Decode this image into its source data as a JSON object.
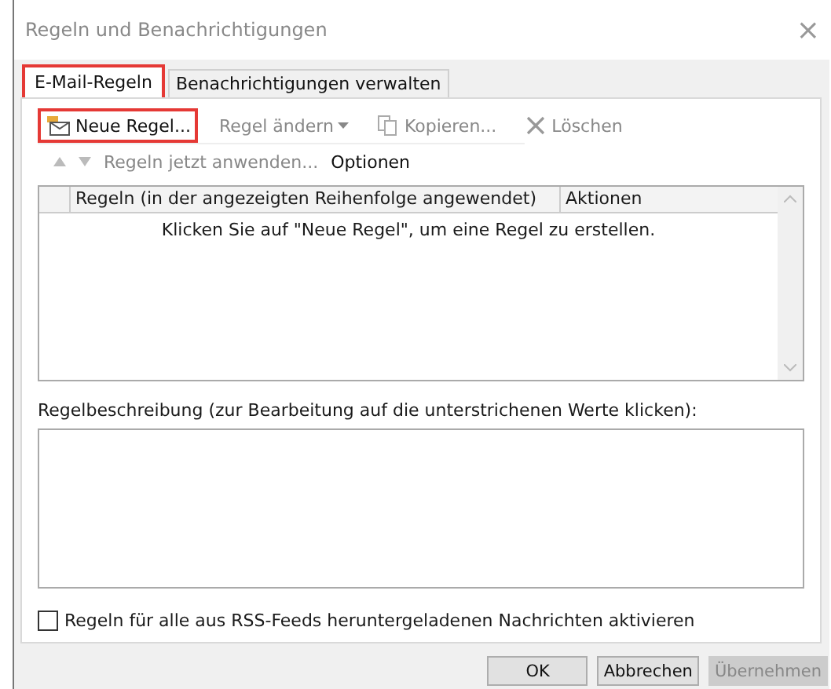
{
  "window": {
    "title": "Regeln und Benachrichtigungen",
    "close": "×"
  },
  "tabs": [
    {
      "label": "E-Mail-Regeln",
      "selected": true,
      "highlighted": true
    },
    {
      "label": "Benachrichtigungen verwalten",
      "selected": false,
      "highlighted": false
    }
  ],
  "toolbar": [
    {
      "kind": "new",
      "label": "Neue Regel...",
      "disabled": false,
      "highlighted": true
    },
    {
      "kind": "change",
      "label": "Regel ändern",
      "disabled": true,
      "highlighted": false
    },
    {
      "kind": "copy",
      "label": "Kopieren...",
      "disabled": true,
      "highlighted": false
    },
    {
      "kind": "delete",
      "label": "Löschen",
      "disabled": true,
      "highlighted": false
    }
  ],
  "secondary_toolbar": {
    "move_up_disabled": true,
    "move_down_disabled": true,
    "links": [
      {
        "label": "Regeln jetzt anwenden...",
        "disabled": true
      },
      {
        "label": "Optionen",
        "disabled": false
      }
    ]
  },
  "table": {
    "columns": [
      "Regeln (in der angezeigten Reihenfolge angewendet)",
      "Aktionen"
    ],
    "empty_message": "Klicken Sie auf \"Neue Regel\", um eine Regel zu erstellen."
  },
  "description": {
    "label": "Regelbeschreibung (zur Bearbeitung auf die unterstrichenen Werte klicken):"
  },
  "rss_checkbox": {
    "label": "Regeln für alle aus RSS-Feeds heruntergeladenen Nachrichten aktivieren",
    "checked": false
  },
  "buttons": [
    {
      "label": "OK",
      "disabled": false
    },
    {
      "label": "Abbrechen",
      "disabled": false
    },
    {
      "label": "Übernehmen",
      "disabled": true
    }
  ]
}
